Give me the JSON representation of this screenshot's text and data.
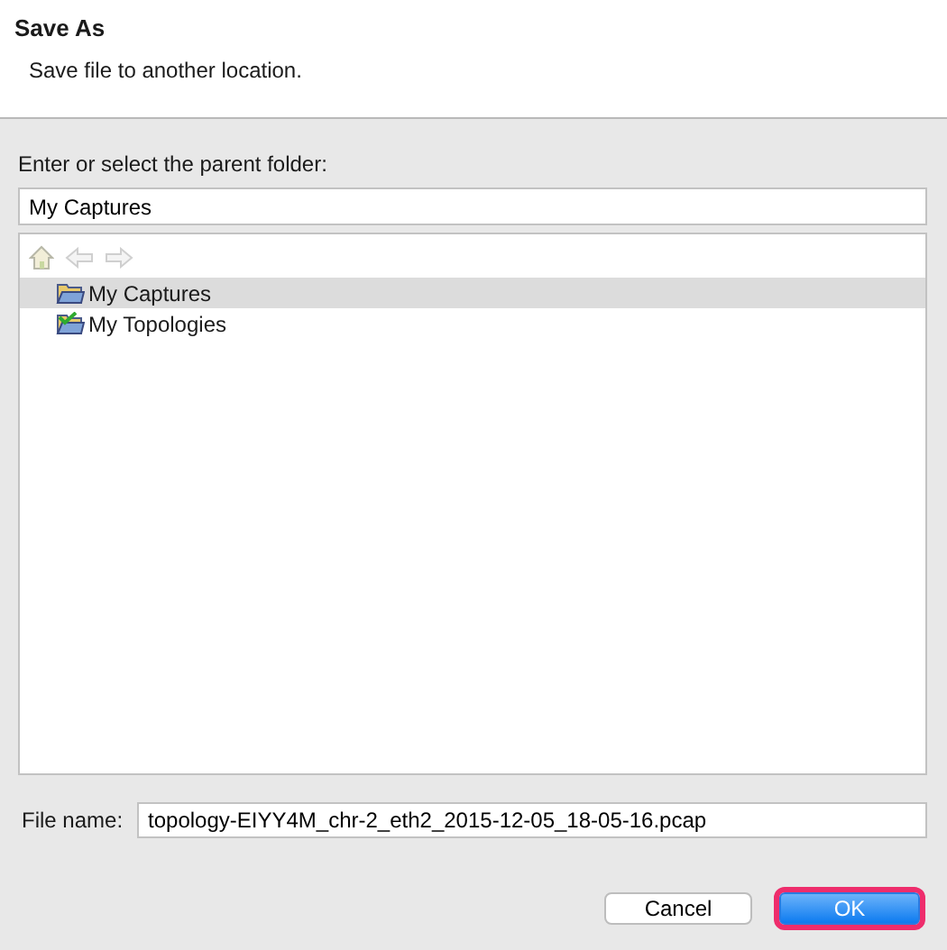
{
  "header": {
    "title": "Save As",
    "message": "Save file to another location."
  },
  "folder": {
    "label": "Enter or select the parent folder:",
    "value": "My Captures"
  },
  "tree": {
    "items": [
      {
        "label": "My Captures",
        "kind": "folder",
        "selected": true
      },
      {
        "label": "My Topologies",
        "kind": "checked-folder",
        "selected": false
      }
    ]
  },
  "file_name": {
    "label": "File name:",
    "value": "topology-EIYY4M_chr-2_eth2_2015-12-05_18-05-16.pcap"
  },
  "buttons": [
    {
      "label": "Cancel",
      "kind": "default",
      "highlighted": false
    },
    {
      "label": "OK",
      "kind": "primary",
      "highlighted": true
    }
  ]
}
